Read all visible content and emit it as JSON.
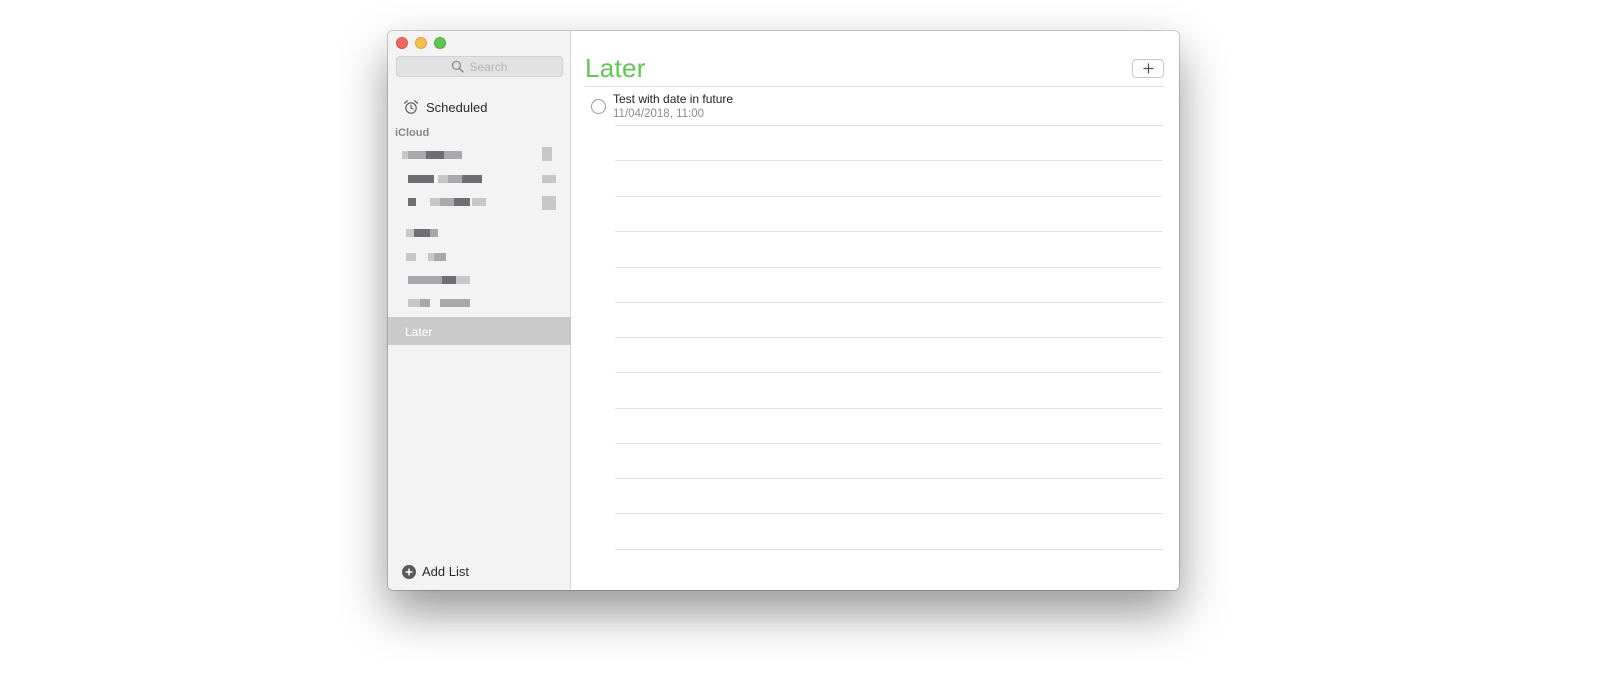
{
  "window": {
    "traffic_lights": [
      "close",
      "minimize",
      "zoom"
    ]
  },
  "sidebar": {
    "search": {
      "placeholder": "Search",
      "icon": "search-icon"
    },
    "smart_list": {
      "label": "Scheduled",
      "icon": "alarm-clock-icon"
    },
    "section_header": "iCloud",
    "lists_redacted_count": 7,
    "selected_list": "Later",
    "add_list": {
      "label": "Add List",
      "icon": "plus-circle-icon"
    }
  },
  "main": {
    "title": "Later",
    "add_button_icon": "plus-icon",
    "reminders": [
      {
        "title": "Test with date in future",
        "due": "11/04/2018, 11:00",
        "completed": false
      }
    ]
  },
  "colors": {
    "accent_green": "#62c556",
    "selection_gray": "#cbcacb",
    "traffic_close": "#ed6a5e",
    "traffic_minimize": "#f5bf4f",
    "traffic_zoom": "#62c654"
  }
}
